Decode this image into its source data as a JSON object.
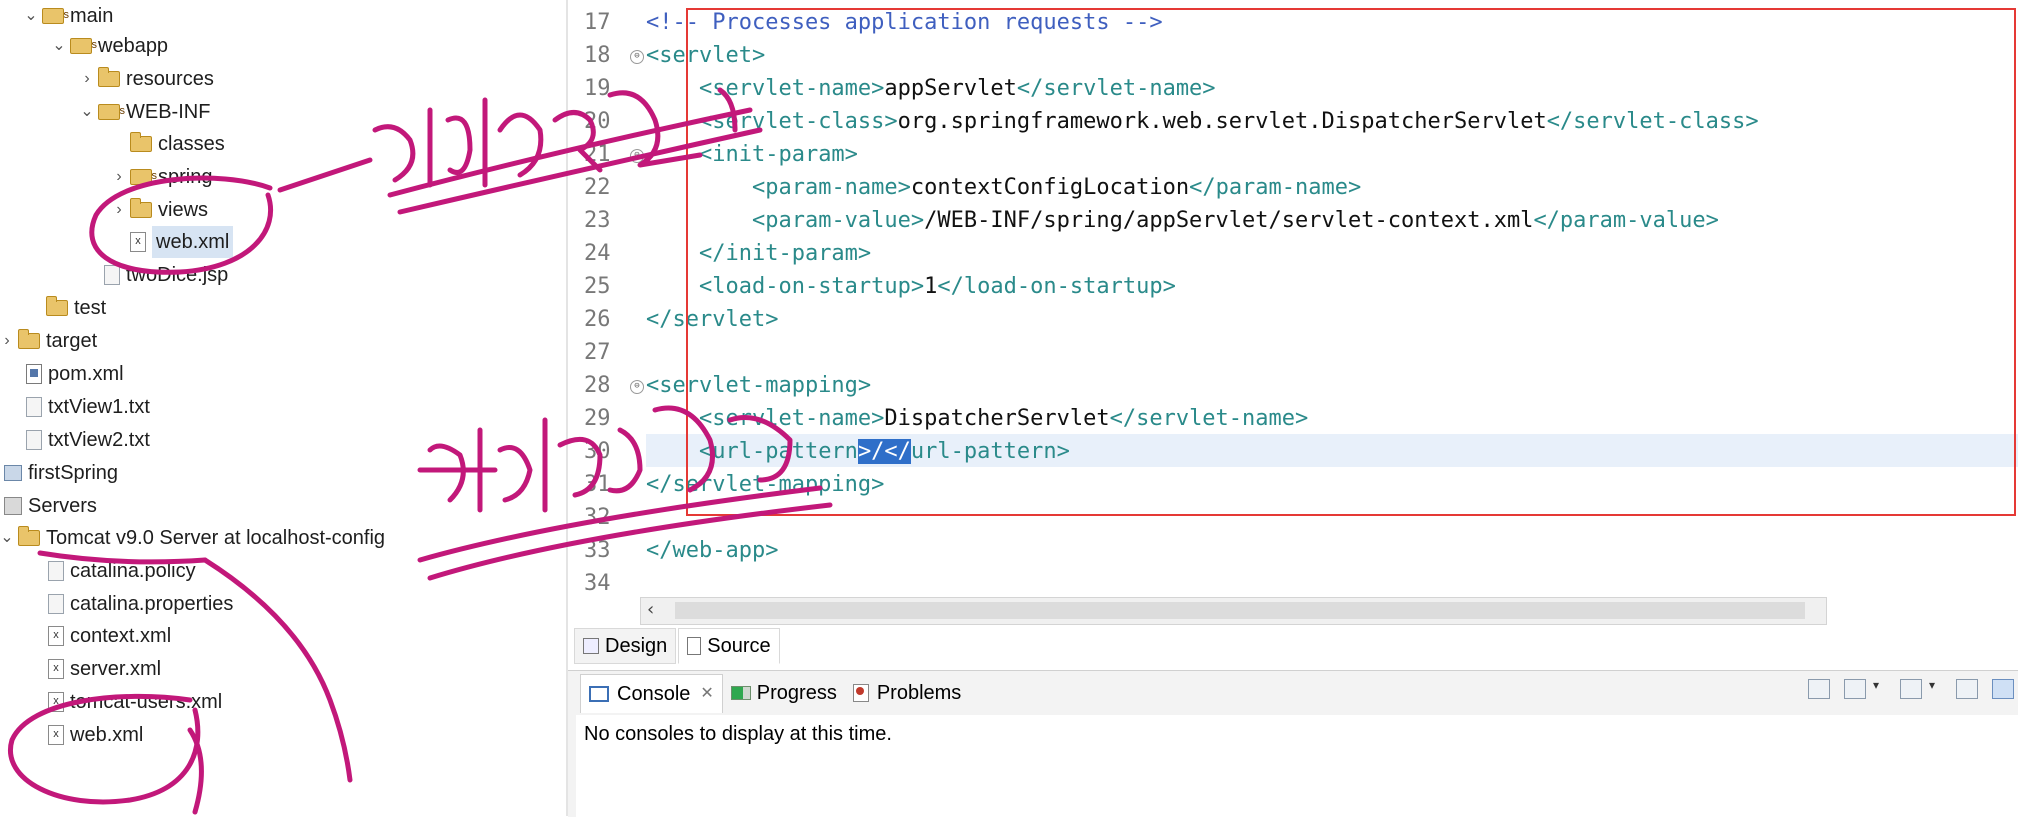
{
  "explorer": {
    "items": [
      {
        "label": "main",
        "type": "pkgfolder",
        "twisty": "⌄"
      },
      {
        "label": "webapp",
        "type": "pkgfolder",
        "twisty": "⌄"
      },
      {
        "label": "resources",
        "type": "folder",
        "twisty": "›"
      },
      {
        "label": "WEB-INF",
        "type": "pkgfolder",
        "twisty": "⌄"
      },
      {
        "label": "classes",
        "type": "folder",
        "twisty": ""
      },
      {
        "label": "spring",
        "type": "pkgfolder",
        "twisty": "›"
      },
      {
        "label": "views",
        "type": "folder",
        "twisty": "›"
      },
      {
        "label": "web.xml",
        "type": "xfile",
        "twisty": ""
      },
      {
        "label": "twoDice.jsp",
        "type": "file",
        "twisty": ""
      },
      {
        "label": "test",
        "type": "folder",
        "twisty": ""
      },
      {
        "label": "target",
        "type": "folder",
        "twisty": "›"
      },
      {
        "label": "pom.xml",
        "type": "pom",
        "twisty": ""
      },
      {
        "label": "txtView1.txt",
        "type": "file",
        "twisty": ""
      },
      {
        "label": "txtView2.txt",
        "type": "file",
        "twisty": ""
      },
      {
        "label": "firstSpring",
        "type": "project",
        "twisty": ""
      },
      {
        "label": "Servers",
        "type": "server",
        "twisty": ""
      },
      {
        "label": "Tomcat v9.0 Server at localhost-config",
        "type": "folder",
        "twisty": "⌄"
      },
      {
        "label": "catalina.policy",
        "type": "file",
        "twisty": ""
      },
      {
        "label": "catalina.properties",
        "type": "file",
        "twisty": ""
      },
      {
        "label": "context.xml",
        "type": "xfile",
        "twisty": ""
      },
      {
        "label": "server.xml",
        "type": "xfile",
        "twisty": ""
      },
      {
        "label": "tomcat-users.xml",
        "type": "xfile",
        "twisty": ""
      },
      {
        "label": "web.xml",
        "type": "xfile",
        "twisty": ""
      }
    ]
  },
  "editor": {
    "line_numbers": [
      "17",
      "18",
      "19",
      "20",
      "21",
      "22",
      "23",
      "24",
      "25",
      "26",
      "27",
      "28",
      "29",
      "30",
      "31",
      "32",
      "33",
      "34"
    ],
    "lines": [
      {
        "indent": "",
        "parts": [
          {
            "c": "cmt",
            "t": "<!-- Processes application requests -->"
          }
        ]
      },
      {
        "indent": "",
        "parts": [
          {
            "c": "tag",
            "t": "<servlet>"
          }
        ]
      },
      {
        "indent": "    ",
        "parts": [
          {
            "c": "tag",
            "t": "<servlet-name>"
          },
          {
            "c": "txt",
            "t": "appServlet"
          },
          {
            "c": "tag",
            "t": "</servlet-name>"
          }
        ]
      },
      {
        "indent": "    ",
        "parts": [
          {
            "c": "tag",
            "t": "<servlet-class>"
          },
          {
            "c": "txt",
            "t": "org.springframework.web.servlet.DispatcherServlet"
          },
          {
            "c": "tag",
            "t": "</servlet-class>"
          }
        ]
      },
      {
        "indent": "    ",
        "parts": [
          {
            "c": "tag",
            "t": "<init-param>"
          }
        ]
      },
      {
        "indent": "        ",
        "parts": [
          {
            "c": "tag",
            "t": "<param-name>"
          },
          {
            "c": "txt",
            "t": "contextConfigLocation"
          },
          {
            "c": "tag",
            "t": "</param-name>"
          }
        ]
      },
      {
        "indent": "        ",
        "parts": [
          {
            "c": "tag",
            "t": "<param-value>"
          },
          {
            "c": "txt",
            "t": "/WEB-INF/spring/appServlet/servlet-context.xml"
          },
          {
            "c": "tag",
            "t": "</param-value>"
          }
        ]
      },
      {
        "indent": "    ",
        "parts": [
          {
            "c": "tag",
            "t": "</init-param>"
          }
        ]
      },
      {
        "indent": "    ",
        "parts": [
          {
            "c": "tag",
            "t": "<load-on-startup>"
          },
          {
            "c": "txt",
            "t": "1"
          },
          {
            "c": "tag",
            "t": "</load-on-startup>"
          }
        ]
      },
      {
        "indent": "",
        "parts": [
          {
            "c": "tag",
            "t": "</servlet>"
          }
        ]
      },
      {
        "indent": "",
        "parts": []
      },
      {
        "indent": "",
        "parts": [
          {
            "c": "tag",
            "t": "<servlet-mapping>"
          }
        ]
      },
      {
        "indent": "    ",
        "parts": [
          {
            "c": "tag",
            "t": "<servlet-name>"
          },
          {
            "c": "txt",
            "t": "DispatcherServlet"
          },
          {
            "c": "tag",
            "t": "</servlet-name>"
          }
        ]
      },
      {
        "indent": "    ",
        "parts": [
          {
            "c": "tag",
            "t": "<url-pattern"
          },
          {
            "c": "hl",
            "t": ">/</"
          },
          {
            "c": "tag",
            "t": "url-pattern>"
          }
        ]
      },
      {
        "indent": "",
        "parts": [
          {
            "c": "tag",
            "t": "</servlet-mapping>"
          }
        ]
      },
      {
        "indent": "",
        "parts": []
      },
      {
        "indent": "",
        "parts": [
          {
            "c": "tag",
            "t": "</web-app>"
          }
        ]
      },
      {
        "indent": "",
        "parts": []
      }
    ],
    "tabs": [
      {
        "label": "Design",
        "icon": "design-icon"
      },
      {
        "label": "Source",
        "icon": "source-icon"
      }
    ]
  },
  "console": {
    "tabs": {
      "console": "Console",
      "close": "✕",
      "progress": "Progress",
      "problems": "Problems"
    },
    "message": "No consoles to display at this time."
  },
  "colors": {
    "annotation_ink": "#c2187a",
    "highlight_box": "#e53935",
    "tag": "#2a8a8a",
    "comment": "#3f5fbf",
    "selection": "#2f6fc9"
  }
}
